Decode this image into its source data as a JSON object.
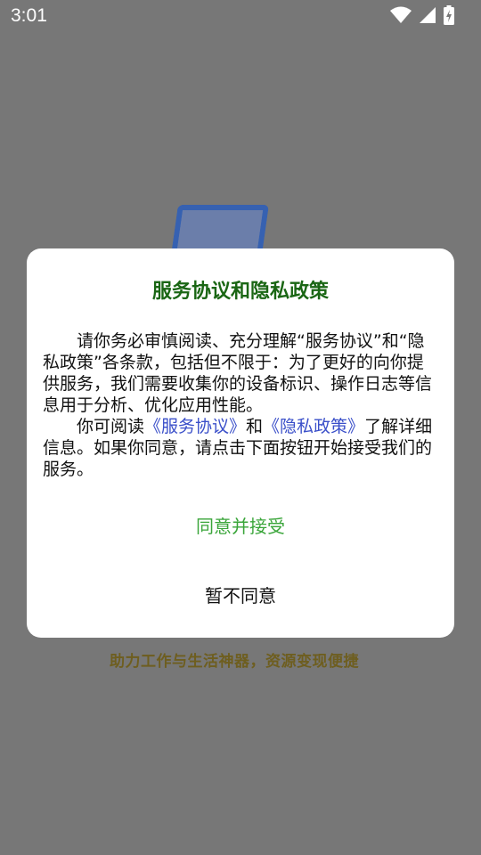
{
  "status_bar": {
    "time": "3:01",
    "icons": [
      "wifi-icon",
      "signal-icon",
      "battery-charging-icon"
    ]
  },
  "splash": {
    "slogan": "助力工作与生活神器，资源变现便捷"
  },
  "dialog": {
    "title": "服务协议和隐私政策",
    "paragraph1": "请你务必审慎阅读、充分理解“服务协议”和“隐私政策”各条款，包括但不限于：为了更好的向你提供服务，我们需要收集你的设备标识、操作日志等信息用于分析、优化应用性能。",
    "paragraph2_prefix": "你可阅读",
    "link_service": "《服务协议》",
    "paragraph2_and": "和",
    "link_privacy": "《隐私政策》",
    "paragraph2_suffix": "了解详细信息。如果你同意，请点击下面按钮开始接受我们的服务。",
    "accept_label": "同意并接受",
    "decline_label": "暂不同意"
  },
  "colors": {
    "title": "#1a6614",
    "accept": "#3aa53a",
    "link": "#3a4fc9",
    "overlay": "#777777"
  }
}
